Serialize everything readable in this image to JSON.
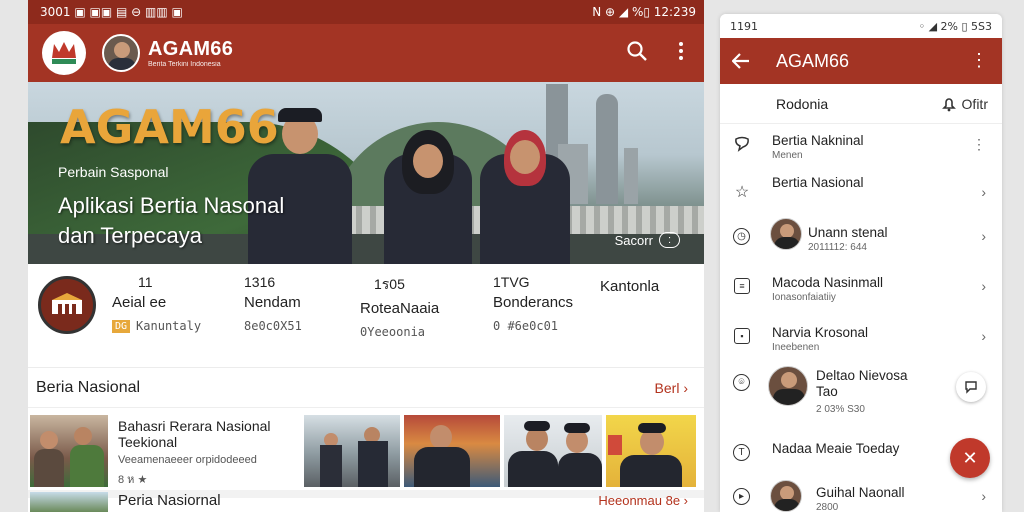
{
  "left": {
    "statusbar": {
      "left": "3001 ▣ ▣▣ ▤ ⊖ ▥▥ ▣",
      "right": "N ⊕ ◢ %▯ 12:239"
    },
    "appbar": {
      "title": "AGAM66",
      "subtitle": "Berita Terkini Indonesia"
    },
    "banner": {
      "title": "AGAM66",
      "subtitle": "Perbain Sasponal",
      "headline1": "Aplikasi Bertia Nasonal",
      "headline2": "dan Terpecaya",
      "more_label": "Sacorr",
      "more_pill": ":"
    },
    "stats": [
      {
        "num": "11",
        "label": "Aeial ee",
        "sub": "Kanuntaly",
        "badge": "DG"
      },
      {
        "num": "1316",
        "label": "Nendam",
        "sub": "8e0c0X51"
      },
      {
        "num": "1ร05",
        "label": "RoteaNaaia",
        "sub": "0Yeeoonia"
      },
      {
        "num": "1TVG",
        "label": "Bonderancs",
        "sub": "0 #6e0c01"
      },
      {
        "num": "",
        "label": "Kantonla",
        "sub": ""
      }
    ],
    "section": {
      "title": "Beria Nasional",
      "more": "Berl"
    },
    "news": [
      {
        "headline": "Bahasri Rerara Nasional Teekional",
        "desc": "Veeamenaeeer orpidodeeed",
        "meta": "8 ห ★"
      }
    ],
    "row2": {
      "title": "Peria Nasiornal",
      "more": "Heeonmau 8e"
    }
  },
  "right": {
    "statusbar": {
      "left": "1191",
      "right": "◦ ◢ 2% ▯ 5S3"
    },
    "appbar": {
      "title": "AGAM66"
    },
    "top": {
      "left": "Rodonia",
      "right": "Ofitr"
    },
    "items": [
      {
        "title": "Bertia Nakninal",
        "sub": "Menen",
        "icon": "comment-icon",
        "trail": "⋮"
      },
      {
        "title": "Bertia Nasional",
        "sub": "",
        "icon": "star-icon",
        "trail": "›"
      },
      {
        "title": "Unann stenal",
        "sub": "2011112: 644",
        "icon": "clock-icon",
        "trail": "›"
      },
      {
        "title": "Macoda Nasinmall",
        "sub": "Ionasonfaiatiiy",
        "icon": "doc-icon",
        "trail": "›"
      },
      {
        "title": "Narvia Krosonal",
        "sub": "Ineebenen",
        "icon": "square-icon",
        "trail": "›"
      },
      {
        "title": "Deltao Nievosa Tao",
        "sub": "2 03% S30",
        "icon": "location-icon",
        "trail": ""
      },
      {
        "title": "Nadaa Meaie Toeday",
        "sub": "",
        "icon": "t-icon",
        "trail": ""
      },
      {
        "title": "Guihal Naonall",
        "sub": "2800",
        "icon": "play-icon",
        "trail": "›"
      }
    ],
    "fab": "✕"
  },
  "colors": {
    "primary": "#a33424",
    "statusbar": "#8e2a1c",
    "accent": "#e9a53a",
    "link": "#b3331e"
  }
}
